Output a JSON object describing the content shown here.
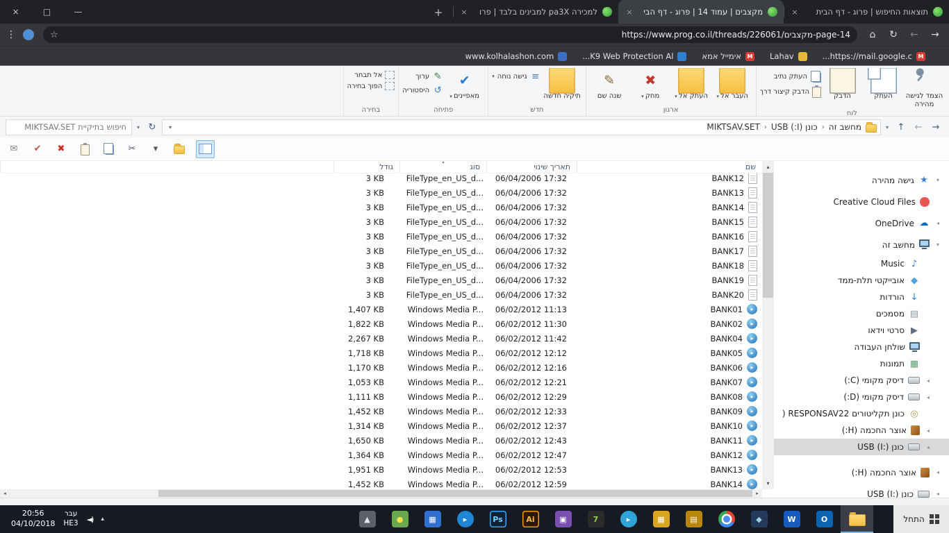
{
  "glyphs": {
    "close": "×",
    "dropdown": "▾",
    "crumb_sep": "‹",
    "sort": "▴",
    "chev_open": "▾",
    "chev_closed": "◂",
    "up_arrow": "▴",
    "down_arrow": "▾",
    "left_arrow": "◂",
    "right_arrow": "▸"
  },
  "browser": {
    "window_controls": {
      "close": "×",
      "maximize": "□",
      "minimize": "—"
    },
    "tabs": [
      {
        "title": "תוצאות החיפוש | פרוג - דף הבית",
        "active": false
      },
      {
        "title": "מקצבים | עמוד 14 | פרוג - דף הבי",
        "active": true
      },
      {
        "title": "למכירה pa3X למבינים בלבד | פרו",
        "active": false
      }
    ],
    "new_tab_glyph": "+",
    "toolbar": {
      "back": "→",
      "forward": "←",
      "reload": "↻",
      "home": "⌂",
      "url": "https://www.prog.co.il/threads/226061/מקצבים-page-14",
      "star": "☆",
      "menu": "⋮"
    },
    "bookmarks": [
      {
        "label": "https://mail.google.c...",
        "color": "#d93b30",
        "glyph": "M"
      },
      {
        "label": "Lahav",
        "color": "#e8b73a",
        "glyph": ""
      },
      {
        "label": "אימייל אמא",
        "color": "#d93b30",
        "glyph": "M"
      },
      {
        "label": "K9 Web Protection Al...",
        "color": "#2f7fd3",
        "glyph": ""
      },
      {
        "label": "www.kolhalashon.com",
        "color": "#3a6fc4",
        "glyph": ""
      }
    ]
  },
  "explorer": {
    "ribbon": {
      "groups": [
        {
          "label": "לוח",
          "items": [
            {
              "label": "הצמד לגישה מהירה",
              "size": "large",
              "icon": {
                "name": "pin-icon",
                "shape": "pin"
              }
            },
            {
              "label": "העתק",
              "size": "large",
              "icon": {
                "name": "copy-icon",
                "shape": "copy"
              }
            },
            {
              "label": "הדבק",
              "size": "large",
              "icon": {
                "name": "paste-icon",
                "shape": "clip"
              }
            },
            {
              "label": "העתק נתיב",
              "size": "small",
              "icon": {
                "name": "copy-path-icon",
                "shape": "copy"
              }
            },
            {
              "label": "הדבק קיצור דרך",
              "size": "small",
              "icon": {
                "name": "paste-shortcut-icon",
                "shape": "clip"
              }
            }
          ]
        },
        {
          "label": "ארגון",
          "items": [
            {
              "label": "העבר אל",
              "size": "large",
              "drop": true,
              "icon": {
                "name": "move-to-icon",
                "shape": "folder"
              }
            },
            {
              "label": "העתק אל",
              "size": "large",
              "drop": true,
              "icon": {
                "name": "copy-to-icon",
                "shape": "folder"
              }
            },
            {
              "label": "מחק",
              "size": "large",
              "drop": true,
              "icon": {
                "name": "delete-icon",
                "glyph": "✖",
                "color": "#c0392b"
              }
            },
            {
              "label": "שנה שם",
              "size": "large",
              "icon": {
                "name": "rename-icon",
                "glyph": "✎",
                "color": "#8a6d3b"
              }
            }
          ]
        },
        {
          "label": "חדש",
          "items": [
            {
              "label": "תיקיה חדשה",
              "size": "large",
              "icon": {
                "name": "new-folder-icon",
                "shape": "folder"
              }
            },
            {
              "label": "גישה נוחה",
              "size": "small",
              "drop": true,
              "icon": {
                "name": "easy-access-icon",
                "glyph": "≡",
                "color": "#4a7ab5"
              }
            }
          ]
        },
        {
          "label": "פתיחה",
          "items": [
            {
              "label": "מאפיינים",
              "size": "large",
              "drop": true,
              "icon": {
                "name": "properties-icon",
                "glyph": "✔",
                "color": "#2d7dd2"
              }
            },
            {
              "label": "ערוך",
              "size": "small",
              "icon": {
                "name": "edit-icon",
                "glyph": "✎",
                "color": "#3d7d4f"
              }
            },
            {
              "label": "היסטוריה",
              "size": "small",
              "icon": {
                "name": "history-icon",
                "glyph": "↺",
                "color": "#2d7dd2"
              }
            }
          ]
        },
        {
          "label": "בחירה",
          "items": [
            {
              "label": "אל תבחר",
              "size": "small",
              "icon": {
                "name": "select-none-icon",
                "shape": "dashed"
              }
            },
            {
              "label": "הפוך בחירה",
              "size": "small",
              "icon": {
                "name": "invert-selection-icon",
                "shape": "dashed"
              }
            }
          ]
        }
      ]
    },
    "address": {
      "back": "→",
      "forward": "←",
      "up": "↑",
      "dropdown": "▾",
      "refresh": "↻",
      "breadcrumb": [
        "מחשב זה",
        "כונן (I:) USB",
        "MIKTSAV.SET"
      ],
      "search_placeholder": "חיפוש בתיקיית MIKTSAV.SET"
    },
    "quick_toolbar": [
      {
        "name": "mail",
        "glyph": "✉",
        "color": "#7a8088"
      },
      {
        "name": "confirm",
        "glyph": "✔",
        "color": "#c9503c"
      },
      {
        "name": "cancel",
        "glyph": "✖",
        "color": "#d02b20"
      },
      {
        "name": "paste",
        "shape": "clip"
      },
      {
        "name": "copy",
        "shape": "copy"
      },
      {
        "name": "cut",
        "glyph": "✂",
        "color": "#4f5b66"
      },
      {
        "name": "cut-dropdown",
        "glyph": "▾",
        "color": "#4f5b66"
      },
      {
        "name": "new-folder",
        "shape": "folder"
      },
      {
        "name": "preview-pane",
        "shape": "pane",
        "active": true
      }
    ],
    "columns": [
      {
        "label": "שם",
        "sorted": false
      },
      {
        "label": "תאריך שינוי",
        "sorted": false
      },
      {
        "label": "סוג",
        "sorted": true
      },
      {
        "label": "גודל",
        "sorted": false
      }
    ],
    "files": [
      {
        "name": "BANK12",
        "date": "06/04/2006 17:32",
        "type": "FileType_en_US_d...",
        "size": "3 KB",
        "kind": "filetype"
      },
      {
        "name": "BANK13",
        "date": "06/04/2006 17:32",
        "type": "FileType_en_US_d...",
        "size": "3 KB",
        "kind": "filetype"
      },
      {
        "name": "BANK14",
        "date": "06/04/2006 17:32",
        "type": "FileType_en_US_d...",
        "size": "3 KB",
        "kind": "filetype"
      },
      {
        "name": "BANK15",
        "date": "06/04/2006 17:32",
        "type": "FileType_en_US_d...",
        "size": "3 KB",
        "kind": "filetype"
      },
      {
        "name": "BANK16",
        "date": "06/04/2006 17:32",
        "type": "FileType_en_US_d...",
        "size": "3 KB",
        "kind": "filetype"
      },
      {
        "name": "BANK17",
        "date": "06/04/2006 17:32",
        "type": "FileType_en_US_d...",
        "size": "3 KB",
        "kind": "filetype"
      },
      {
        "name": "BANK18",
        "date": "06/04/2006 17:32",
        "type": "FileType_en_US_d...",
        "size": "3 KB",
        "kind": "filetype"
      },
      {
        "name": "BANK19",
        "date": "06/04/2006 17:32",
        "type": "FileType_en_US_d...",
        "size": "3 KB",
        "kind": "filetype"
      },
      {
        "name": "BANK20",
        "date": "06/04/2006 17:32",
        "type": "FileType_en_US_d...",
        "size": "3 KB",
        "kind": "filetype"
      },
      {
        "name": "BANK01",
        "date": "06/02/2012 11:13",
        "type": "Windows Media P...",
        "size": "1,407 KB",
        "kind": "media"
      },
      {
        "name": "BANK02",
        "date": "06/02/2012 11:30",
        "type": "Windows Media P...",
        "size": "1,822 KB",
        "kind": "media"
      },
      {
        "name": "BANK04",
        "date": "06/02/2012 11:42",
        "type": "Windows Media P...",
        "size": "2,267 KB",
        "kind": "media"
      },
      {
        "name": "BANK05",
        "date": "06/02/2012 12:12",
        "type": "Windows Media P...",
        "size": "1,718 KB",
        "kind": "media"
      },
      {
        "name": "BANK06",
        "date": "06/02/2012 12:16",
        "type": "Windows Media P...",
        "size": "1,170 KB",
        "kind": "media"
      },
      {
        "name": "BANK07",
        "date": "06/02/2012 12:21",
        "type": "Windows Media P...",
        "size": "1,053 KB",
        "kind": "media"
      },
      {
        "name": "BANK08",
        "date": "06/02/2012 12:29",
        "type": "Windows Media P...",
        "size": "1,111 KB",
        "kind": "media"
      },
      {
        "name": "BANK09",
        "date": "06/02/2012 12:33",
        "type": "Windows Media P...",
        "size": "1,452 KB",
        "kind": "media"
      },
      {
        "name": "BANK10",
        "date": "06/02/2012 12:37",
        "type": "Windows Media P...",
        "size": "1,314 KB",
        "kind": "media"
      },
      {
        "name": "BANK11",
        "date": "06/02/2012 12:43",
        "type": "Windows Media P...",
        "size": "1,650 KB",
        "kind": "media"
      },
      {
        "name": "BANK12",
        "date": "06/02/2012 12:47",
        "type": "Windows Media P...",
        "size": "1,364 KB",
        "kind": "media"
      },
      {
        "name": "BANK13",
        "date": "06/02/2012 12:53",
        "type": "Windows Media P...",
        "size": "1,951 KB",
        "kind": "media"
      },
      {
        "name": "BANK14",
        "date": "06/02/2012 12:59",
        "type": "Windows Media P...",
        "size": "1,452 KB",
        "kind": "media"
      }
    ],
    "sidebar": [
      {
        "label": "גישה מהירה",
        "level": 0,
        "chevron": "open",
        "icon": {
          "name": "quick-access-icon",
          "glyph": "★",
          "color": "#3b82d6"
        }
      },
      {
        "label": "Creative Cloud Files",
        "level": 0,
        "chevron": "none",
        "icon": {
          "name": "creative-cloud-icon",
          "shape": "circle",
          "bg": "#e9564b"
        }
      },
      {
        "label": "OneDrive",
        "level": 0,
        "chevron": "closed",
        "icon": {
          "name": "onedrive-icon",
          "glyph": "☁",
          "color": "#0a6cc4"
        }
      },
      {
        "label": "מחשב זה",
        "level": 0,
        "chevron": "open",
        "icon": {
          "name": "this-pc-icon",
          "shape": "monitor"
        }
      },
      {
        "label": "Music",
        "level": 1,
        "chevron": "none",
        "icon": {
          "name": "music-icon",
          "glyph": "♪",
          "color": "#3b77c2"
        }
      },
      {
        "label": "אובייקטי תלת-ממד",
        "level": 1,
        "chevron": "none",
        "icon": {
          "name": "3d-objects-icon",
          "glyph": "◆",
          "color": "#4aa0e0"
        }
      },
      {
        "label": "הורדות",
        "level": 1,
        "chevron": "none",
        "icon": {
          "name": "downloads-icon",
          "glyph": "↓",
          "color": "#2b7cd3"
        }
      },
      {
        "label": "מסמכים",
        "level": 1,
        "chevron": "none",
        "icon": {
          "name": "documents-icon",
          "glyph": "▤",
          "color": "#8a97a5"
        }
      },
      {
        "label": "סרטי וידאו",
        "level": 1,
        "chevron": "none",
        "icon": {
          "name": "videos-icon",
          "glyph": "▶",
          "color": "#5f6f7f"
        }
      },
      {
        "label": "שולחן העבודה",
        "level": 1,
        "chevron": "none",
        "icon": {
          "name": "desktop-icon",
          "shape": "monitor"
        }
      },
      {
        "label": "תמונות",
        "level": 1,
        "chevron": "none",
        "icon": {
          "name": "pictures-icon",
          "glyph": "▦",
          "color": "#5a9e6f"
        }
      },
      {
        "label": "דיסק מקומי (C:)",
        "level": 1,
        "chevron": "closed",
        "icon": {
          "name": "local-disk-c-icon",
          "shape": "disk"
        }
      },
      {
        "label": "דיסק מקומי (D:)",
        "level": 1,
        "chevron": "closed",
        "icon": {
          "name": "local-disk-d-icon",
          "shape": "disk"
        }
      },
      {
        "label": "כונן תקליטורים RESPONSAV22 (",
        "level": 1,
        "chevron": "none",
        "icon": {
          "name": "cd-drive-icon",
          "glyph": "◎",
          "color": "#b09a5e"
        }
      },
      {
        "label": "אוצר החכמה (H:)",
        "level": 1,
        "chevron": "closed",
        "icon": {
          "name": "otzar-drive-h-icon",
          "shape": "book"
        }
      },
      {
        "label": "כונן USB (I:)",
        "level": 1,
        "chevron": "closed",
        "selected": true,
        "icon": {
          "name": "usb-drive-icon",
          "shape": "disk"
        }
      },
      {
        "label": "אוצר החכמה (H:)",
        "level": 0,
        "gap": true,
        "chevron": "closed",
        "icon": {
          "name": "otzar-drive-h2-icon",
          "shape": "book"
        }
      },
      {
        "label": "כונן USB (I:)",
        "level": 0,
        "chevron": "closed",
        "icon": {
          "name": "usb-drive-2-icon",
          "shape": "disk"
        }
      }
    ]
  },
  "taskbar": {
    "start_label": "התחל",
    "speaker_glyph": "◄)",
    "hidden_icons_glyph": "▴",
    "language_top": "עבר",
    "language_bottom": "HE3",
    "clock_time": "20:56",
    "clock_date": "04/10/2018",
    "apps": [
      {
        "name": "taskbar-app-icon-1",
        "bg": "#5c6168",
        "glyph": "▲",
        "fg": "#e8e8e8"
      },
      {
        "name": "taskbar-app-icon-2",
        "bg": "#6aa84f",
        "glyph": "●",
        "fg": "#f4e04d"
      },
      {
        "name": "taskbar-app-icon-3",
        "bg": "#2f6fd0",
        "glyph": "▦",
        "fg": "#ffffff"
      },
      {
        "name": "taskbar-app-icon-4",
        "bg": "#1f86d6",
        "glyph": "▸",
        "fg": "#ffffff",
        "round": true
      },
      {
        "name": "photoshop-icon",
        "bg": "#0d2233",
        "border": "#31a8ff",
        "glyph": "Ps",
        "fg": "#7fd0ff"
      },
      {
        "name": "illustrator-icon",
        "bg": "#2a1a05",
        "border": "#ff9a00",
        "glyph": "Ai",
        "fg": "#ffb84d"
      },
      {
        "name": "taskbar-app-icon-7",
        "bg": "#7a4fb0",
        "glyph": "▣",
        "fg": "#ffffff"
      },
      {
        "name": "taskbar-app-icon-8",
        "bg": "#2b2b2b",
        "glyph": "7",
        "fg": "#9ad34f"
      },
      {
        "name": "telegram-icon",
        "bg": "#2ea5d8",
        "glyph": "▸",
        "fg": "#ffffff",
        "round": true
      },
      {
        "name": "taskbar-app-icon-10",
        "bg": "#d9a520",
        "glyph": "▦",
        "fg": "#ffffff"
      },
      {
        "name": "taskbar-app-icon-11",
        "bg": "#b8860b",
        "glyph": "▤",
        "fg": "#ffffff"
      },
      {
        "name": "chrome-icon",
        "shape": "chrome"
      },
      {
        "name": "taskbar-app-icon-13",
        "bg": "#23395d",
        "glyph": "◆",
        "fg": "#9cccdd"
      },
      {
        "name": "word-icon",
        "bg": "#185abd",
        "glyph": "W",
        "fg": "#ffffff"
      },
      {
        "name": "outlook-icon",
        "bg": "#0a64b0",
        "glyph": "O",
        "fg": "#ffffff"
      },
      {
        "name": "file-explorer-icon",
        "shape": "folder",
        "active": true
      }
    ]
  }
}
